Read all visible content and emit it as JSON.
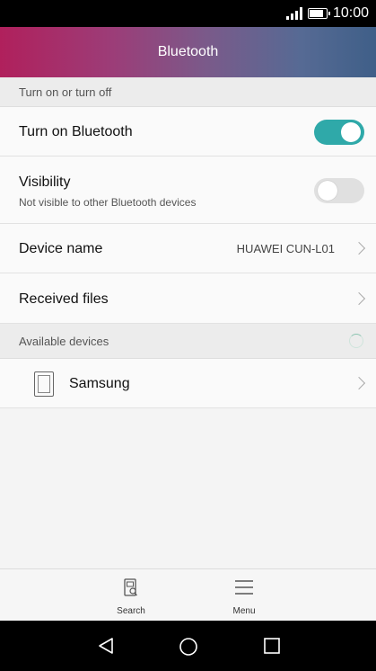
{
  "status_bar": {
    "time": "10:00",
    "battery_level": 0.9
  },
  "header": {
    "title": "Bluetooth"
  },
  "sections": {
    "toggle_section": "Turn on or turn off",
    "available": "Available devices"
  },
  "settings": {
    "turn_on": {
      "label": "Turn on Bluetooth",
      "enabled": true
    },
    "visibility": {
      "label": "Visibility",
      "sublabel": "Not visible to other Bluetooth devices",
      "enabled": false
    },
    "device_name": {
      "label": "Device name",
      "value": "HUAWEI CUN-L01"
    },
    "received_files": {
      "label": "Received files"
    }
  },
  "devices": [
    {
      "name": "Samsung",
      "icon": "phone-icon"
    }
  ],
  "bottom_bar": {
    "search_label": "Search",
    "menu_label": "Menu"
  },
  "colors": {
    "accent": "#2fa9a9",
    "header_start": "#b0205c",
    "header_end": "#3f5f88"
  }
}
